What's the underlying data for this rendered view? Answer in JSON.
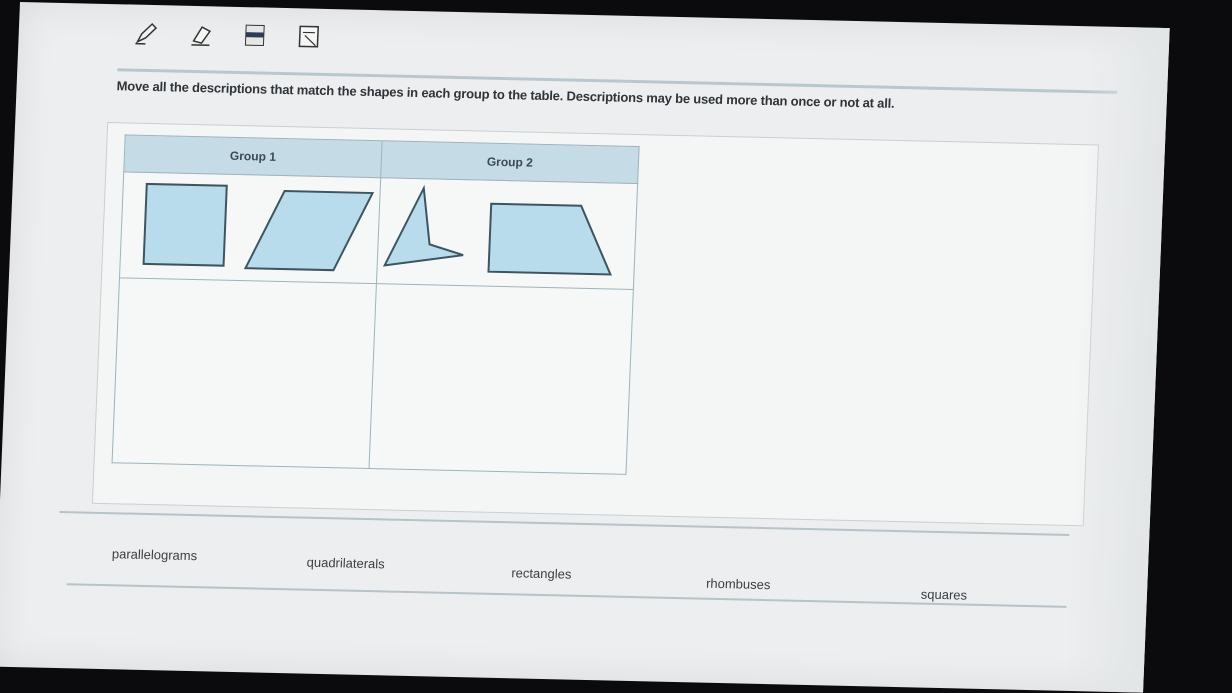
{
  "toolbar": {
    "tools": [
      {
        "name": "pencil-icon"
      },
      {
        "name": "eraser-icon"
      },
      {
        "name": "line-reader-icon"
      },
      {
        "name": "reference-sheet-icon"
      }
    ]
  },
  "instruction": "Move all the descriptions that match the shapes in each group to the table. Descriptions may be used more than once or not at all.",
  "table": {
    "headers": [
      "Group 1",
      "Group 2"
    ],
    "group1_shapes": [
      "square",
      "parallelogram"
    ],
    "group2_shapes": [
      "concave-quadrilateral",
      "trapezoid"
    ],
    "shape_fill": "#b9dcec",
    "shape_stroke": "#3d5561"
  },
  "descriptions": [
    "parallelograms",
    "quadrilaterals",
    "rectangles",
    "rhombuses",
    "squares"
  ]
}
